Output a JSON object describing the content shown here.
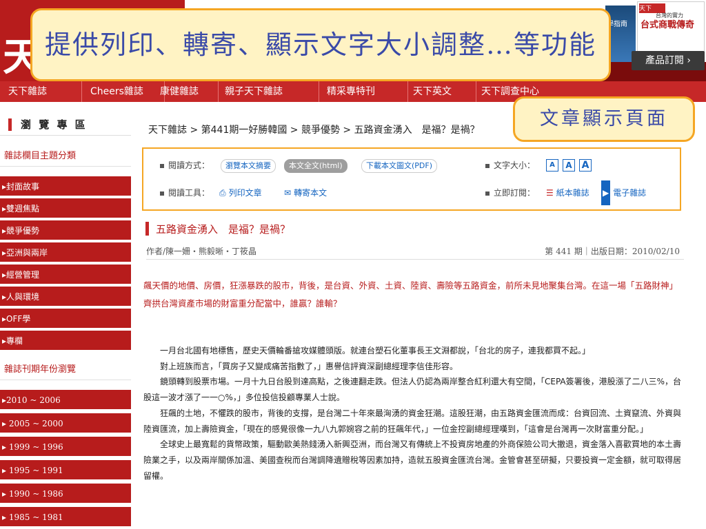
{
  "callouts": {
    "features": "提供列印、轉寄、顯示文字大小調整…等功能",
    "article_page": "文章顯示頁面"
  },
  "header": {
    "logo_glyph": "天",
    "magazine_cover_1": "學指南",
    "magazine_cover_2": {
      "tag": "天下",
      "subtitle": "台灣的實力",
      "title": "台式商戰傳奇"
    },
    "subscribe_button": "產品訂閱 ›"
  },
  "nav": {
    "items": [
      "天下雜誌",
      "Cheers雜誌",
      "康健雜誌",
      "親子天下雜誌",
      "精采專特刊",
      "天下英文",
      "天下調查中心"
    ]
  },
  "sidebar": {
    "title": "瀏 覽 專 區",
    "section_topics": "雜誌欄目主題分類",
    "topics": [
      "▸封面故事",
      "▸雙週焦點",
      "▸競爭優勢",
      "▸亞洲與兩岸",
      "▸經營管理",
      "▸人與環境",
      "▸OFF學",
      "▸專欄"
    ],
    "section_years": "雜誌刊期年份瀏覽",
    "years": [
      "▸2010 ~ 2006",
      "▸ 2005 ~ 2000",
      "▸ 1999 ~ 1996",
      "▸ 1995 ~ 1991",
      "▸ 1990 ~ 1986",
      "▸ 1985 ~ 1981"
    ]
  },
  "breadcrumb": "天下雜誌 > 第441期一好勝韓國 > 競爭優勢 > 五路資金湧入　是福？是禍？",
  "tools": {
    "read_mode_label": "閱讀方式：",
    "read_modes": [
      "瀏覽本文摘要",
      "本文全文(html)",
      "下載本文圖文(PDF)"
    ],
    "font_size_label": "文字大小：",
    "font_sizes": [
      "A",
      "A",
      "A"
    ],
    "read_tools_label": "閱讀工具：",
    "print_label": "列印文章",
    "email_label": "轉寄本文",
    "subscribe_label": "立即訂閱：",
    "print_magazine": "紙本雜誌",
    "e_magazine": "電子雜誌"
  },
  "article": {
    "title": "五路資金湧入　是福？是禍？",
    "authors": "作者/陳一姍・熊毅晰・丁筱晶",
    "issue_info": "第 441 期｜出版日期：2010/02/10",
    "lead": "飆天價的地價、房價，狂漲暴跌的股市，背後，是台資、外資、土資、陸資、壽險等五路資金，前所未見地聚集台灣。在這一場「五路財神」齊拱台灣資產市場的財富重分配當中，誰贏？誰輸？",
    "paragraphs": [
      "一月台北國有地標售，歷史天價輪番搶攻媒體頭版。就連台塑石化董事長王文淵都說，「台北的房子，連我都買不起。」",
      "對上班族而言，「買房子又變成痛苦指數了，」惠譽信評資深副總經理李信佳形容。",
      "鏡頭轉到股票市場。一月十九日台股到達高點，之後連翻走跌。但法人仍認為兩岸整合紅利還大有空間，「CEPA簽署後，港股漲了二八三%，台股這一波才漲了一一○%，」多位投信投顧專業人士說。",
      "狂飆的土地，不懼跌的股市，背後的支撐，是台灣二十年來最洶湧的資金狂潮。這股狂潮，由五路資金匯流而成：台資回流、土資竄流、外資與陸資匯流，加上壽險資金，「現在的感覺很像一九八九郭婉容之前的狂飆年代，」一位金控副總經理嘆到，「這會是台灣再一次財富重分配。」",
      "全球史上最寬鬆的貨幣政策，驅動歐美熱錢湧入新興亞洲，而台灣又有傳統上不投資房地產的外商保險公司大撤退，資金落入喜歡買地的本土壽險業之手，以及兩岸關係加溫、美國查稅而台灣調降遺贈稅等因素加持，造就五股資金匯流台灣。金管會甚至研擬，只要投資一定金額，就可取得居留權。"
    ]
  },
  "colors": {
    "brand_red": "#c62828",
    "callout_fill": "#fff3c4",
    "callout_border": "#f5a623",
    "callout_text": "#3a4aa8",
    "link_blue": "#1565c0"
  }
}
